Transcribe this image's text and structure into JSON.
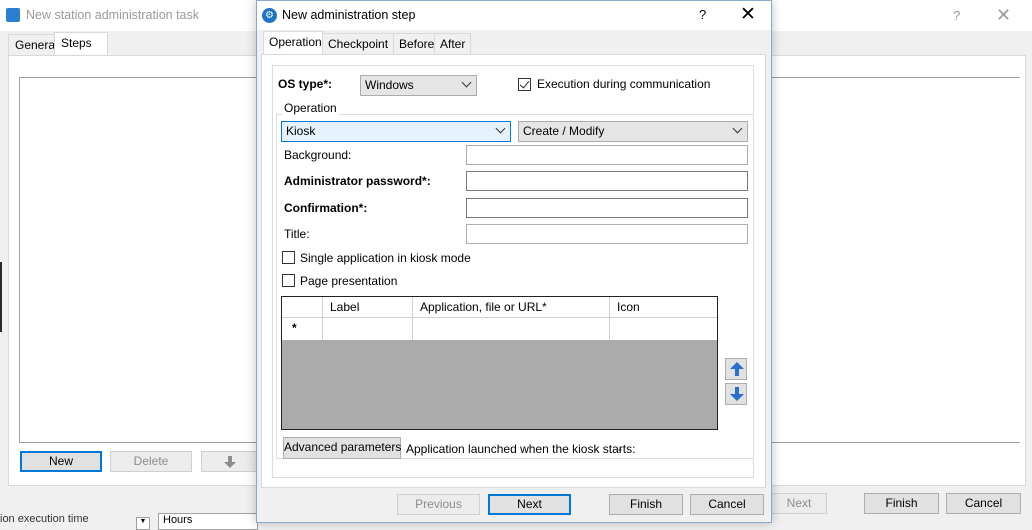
{
  "back_window": {
    "title": "New station administration task",
    "tabs": [
      "General",
      "Steps"
    ],
    "buttons": {
      "new": "New",
      "delete": "Delete"
    },
    "footer": {
      "next": "Next",
      "finish": "Finish",
      "cancel": "Cancel"
    },
    "partial_label": "ion execution time",
    "hours_value": "Hours"
  },
  "dialog": {
    "title": "New administration step",
    "help": "?",
    "close": "✕",
    "tabs": [
      "Operation",
      "Checkpoint",
      "Before",
      "After"
    ],
    "os_type_label": "OS type*:",
    "os_type_value": "Windows",
    "exec_comm_label": "Execution during communication",
    "exec_comm_checked": true,
    "operation_group": "Operation",
    "operation_value": "Kiosk",
    "action_value": "Create / Modify",
    "background_label": "Background:",
    "admin_password_label": "Administrator password*:",
    "confirmation_label": "Confirmation*:",
    "title_label": "Title:",
    "single_app_label": "Single application in kiosk mode",
    "page_presentation_label": "Page presentation",
    "grid": {
      "columns": [
        "Label",
        "Application, file or URL*",
        "Icon"
      ],
      "new_row_marker": "*"
    },
    "advanced_button": "Advanced parameters",
    "app_launched_label": "Application launched when the kiosk starts:",
    "app_launched_value": "-",
    "footer": {
      "previous": "Previous",
      "next": "Next",
      "finish": "Finish",
      "cancel": "Cancel"
    }
  }
}
